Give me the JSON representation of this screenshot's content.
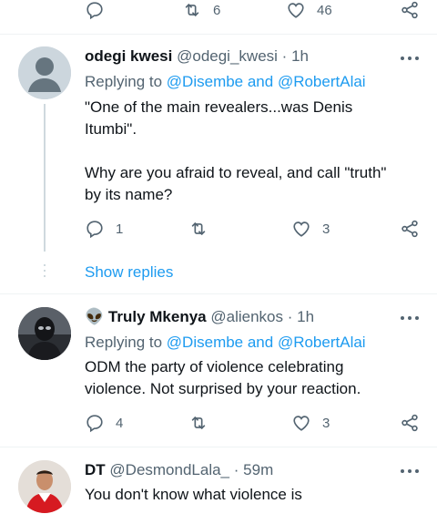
{
  "top_tweet": {
    "retweets": "6",
    "likes": "46"
  },
  "tweets": [
    {
      "name": "odegi kwesi",
      "handle": "@odegi_kwesi",
      "sep": "·",
      "time": "1h",
      "replying_label": "Replying to",
      "replying_to": "@Disembe and @RobertAlai",
      "body_line1": "\"One of the main revealers...was Denis",
      "body_line2": "Itumbi\".",
      "body_line3": "Why are you afraid to reveal, and call \"truth\"",
      "body_line4": "by its name?",
      "replies": "1",
      "retweets": "",
      "likes": "3"
    },
    {
      "emoji": "👽",
      "name": "Truly Mkenya",
      "handle": "@alienkos",
      "sep": "·",
      "time": "1h",
      "replying_label": "Replying to",
      "replying_to": "@Disembe and @RobertAlai",
      "body_line1": "ODM the party of violence celebrating",
      "body_line2": "violence. Not surprised by your reaction.",
      "replies": "4",
      "retweets": "",
      "likes": "3"
    },
    {
      "name": "DT",
      "handle": "@DesmondLala_",
      "sep": "·",
      "time": "59m",
      "body_line1": "You don't know what violence is"
    }
  ],
  "show_replies": "Show replies",
  "colors": {
    "accent": "#1d9bf0",
    "muted": "#536471",
    "divider": "#eff3f4"
  }
}
